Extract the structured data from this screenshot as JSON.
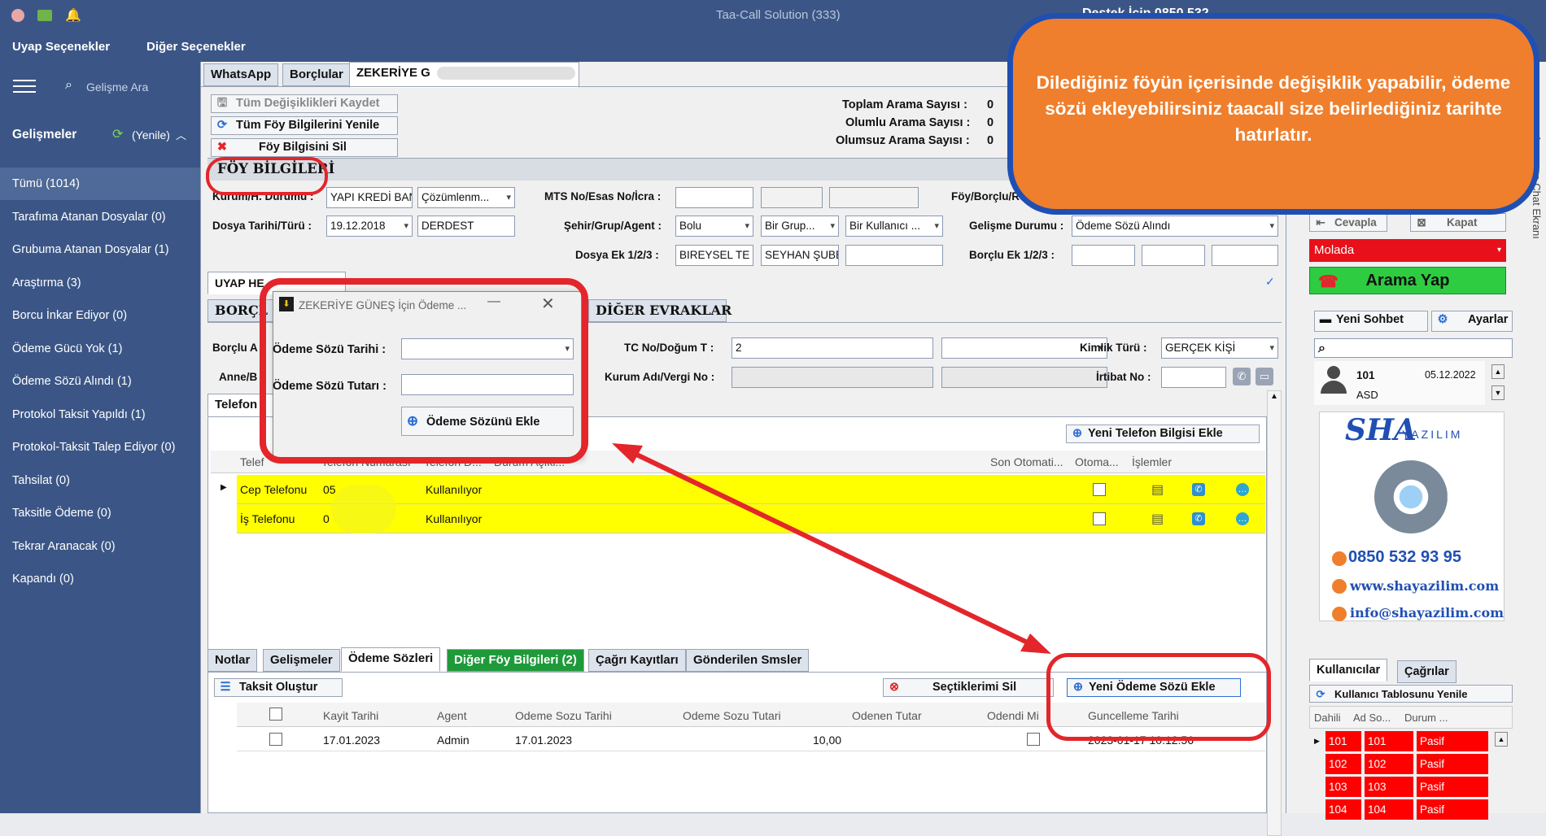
{
  "window": {
    "title": "Taa-Call Solution (333)",
    "support": "Destek İçin 0850 532"
  },
  "menu": {
    "uyap": "Uyap Seçenekler",
    "other": "Diğer Seçenekler"
  },
  "sidebar": {
    "search_placeholder": "Gelişme Ara",
    "section": "Gelişmeler",
    "refresh": "(Yenile)",
    "items": [
      {
        "label": "Tümü (1014)"
      },
      {
        "label": "Tarafıma Atanan Dosyalar (0)"
      },
      {
        "label": "Grubuma Atanan Dosyalar (1)"
      },
      {
        "label": "Araştırma (3)"
      },
      {
        "label": "Borcu İnkar Ediyor (0)"
      },
      {
        "label": "Ödeme Gücü Yok (1)"
      },
      {
        "label": "Ödeme Sözü Alındı (1)"
      },
      {
        "label": "Protokol Taksit Yapıldı (1)"
      },
      {
        "label": "Protokol-Taksit Talep Ediyor (0)"
      },
      {
        "label": "Tahsilat (0)"
      },
      {
        "label": "Taksitle Ödeme (0)"
      },
      {
        "label": "Tekrar Aranacak (0)"
      },
      {
        "label": "Kapandı (0)"
      }
    ]
  },
  "top_tabs": [
    "WhatsApp",
    "Borçlular",
    "ZEKERİYE G"
  ],
  "actions": {
    "save_all": "Tüm Değişiklikleri Kaydet",
    "refresh_all": "Tüm Föy Bilgilerini Yenile",
    "delete": "Föy Bilgisini Sil"
  },
  "stats": {
    "total_label": "Toplam Arama Sayısı :",
    "total": "0",
    "positive_label": "Olumlu Arama Sayısı :",
    "positive": "0",
    "negative_label": "Olumsuz Arama Sayısı :",
    "negative": "0"
  },
  "foy": {
    "section": "FÖY BİLGİLERİ",
    "kurum_label": "Kurum/H. Durumu :",
    "kurum": "YAPI KREDİ BANKA",
    "kurum_status": "Çözümlenm...",
    "mts_label": "MTS No/Esas No/İcra :",
    "foy_borclu_label": "Föy/Borçlu/Ref",
    "dosya_label": "Dosya Tarihi/Türü :",
    "dosya_tarihi": "19.12.2018",
    "dosya_turu": "DERDEST",
    "sehir_label": "Şehir/Grup/Agent :",
    "sehir": "Bolu",
    "grup": "Bir Grup...",
    "agent": "Bir Kullanıcı ...",
    "gelisme_label": "Gelişme Durumu :",
    "gelisme": "Ödeme Sözü Alındı",
    "dosya_ek_label": "Dosya Ek 1/2/3 :",
    "dosya_ek1": "BIREYSEL TE",
    "dosya_ek2": "SEYHAN ŞUBE",
    "borclu_ek_label": "Borçlu Ek 1/2/3 :"
  },
  "sub_tabs": [
    "UYAP HE",
    "BORÇL",
    "DİĞER EVRAKLAR"
  ],
  "borclu": {
    "borclu_label": "Borçlu A",
    "anne_label": "Anne/B",
    "tc_label": "TC No/Doğum T :",
    "tc_value": "2",
    "kimlik_label": "Kimlik Türü :",
    "kimlik": "GERÇEK KİŞİ",
    "kurum_adi_label": "Kurum Adı/Vergi No :",
    "irtibat_label": "İrtibat No :"
  },
  "phone": {
    "tab": "Telefon",
    "add_button": "Yeni Telefon Bilgisi Ekle",
    "columns": [
      "Telef",
      "Telefon Numarası",
      "Telefon D...",
      "Durum Açıkl...",
      "Son Otomati...",
      "Otoma...",
      "İşlemler"
    ],
    "rows": [
      {
        "type": "Cep Telefonu",
        "number": "05",
        "status": "Kullanılıyor"
      },
      {
        "type": "İş Telefonu",
        "number": "0",
        "status": "Kullanılıyor"
      }
    ]
  },
  "dialog": {
    "title": "ZEKERİYE  GÜNEŞ İçin Ödeme ...",
    "date_label": "Ödeme Sözü Tarihi :",
    "amount_label": "Ödeme Sözü Tutarı :",
    "add_button": "Ödeme Sözünü Ekle"
  },
  "bottom_tabs": [
    "Notlar",
    "Gelişmeler",
    "Ödeme Sözleri",
    "Diğer Föy Bilgileri (2)",
    "Çağrı Kayıtları",
    "Gönderilen Smsler"
  ],
  "payments": {
    "installment_button": "Taksit Oluştur",
    "delete_button": "Seçtiklerimi Sil",
    "add_button": "Yeni Ödeme Sözü Ekle",
    "columns": [
      "Kayit Tarihi",
      "Agent",
      "Odeme Sozu Tarihi",
      "Odeme Sozu Tutari",
      "Odenen Tutar",
      "Odendi Mi",
      "Guncelleme Tarihi"
    ],
    "rows": [
      {
        "kayit": "17.01.2023",
        "agent": "Admin",
        "odeme_tarihi": "17.01.2023",
        "tutar": "10,00",
        "odenen": "",
        "guncelleme": "2023-01-17 10:12:56"
      }
    ]
  },
  "right_panel": {
    "answer": "Cevapla",
    "close": "Kapat",
    "status": "Molada",
    "call": "Arama Yap",
    "new_chat": "Yeni Sohbet",
    "settings": "Ayarlar",
    "contact": {
      "ext": "101",
      "date": "05.12.2022",
      "name": "ASD"
    },
    "ad": {
      "brand": "SHA",
      "brand_sub": "YAZILIM",
      "phone": "0850 532 93 95",
      "web": "www.shayazilim.com",
      "email": "info@shayazilim.com"
    },
    "tabs": [
      "Kullanıcılar",
      "Çağrılar"
    ],
    "refresh_users": "Kullanıcı Tablosunu Yenile",
    "user_columns": [
      "Dahili",
      "Ad So...",
      "Durum ..."
    ],
    "users": [
      {
        "dahili": "101",
        "ad": "101",
        "durum": "Pasif"
      },
      {
        "dahili": "102",
        "ad": "102",
        "durum": "Pasif"
      },
      {
        "dahili": "103",
        "ad": "103",
        "durum": "Pasif"
      },
      {
        "dahili": "104",
        "ad": "104",
        "durum": "Pasif"
      }
    ],
    "vertical_text": "Arama ve Chat Ekranı"
  },
  "callout": {
    "text": "Dilediğiniz föyün içerisinde değişiklik yapabilir, ödeme sözü ekleyebilirsiniz taacall size belirlediğiniz tarihte hatırlatır."
  },
  "colors": {
    "sidebar": "#3b5686",
    "accent_red": "#e3262b",
    "callout": "#ef7f2c",
    "callout_border": "#1f4fb3",
    "highlight_yellow": "#ffff00",
    "green": "#2ecc40"
  }
}
